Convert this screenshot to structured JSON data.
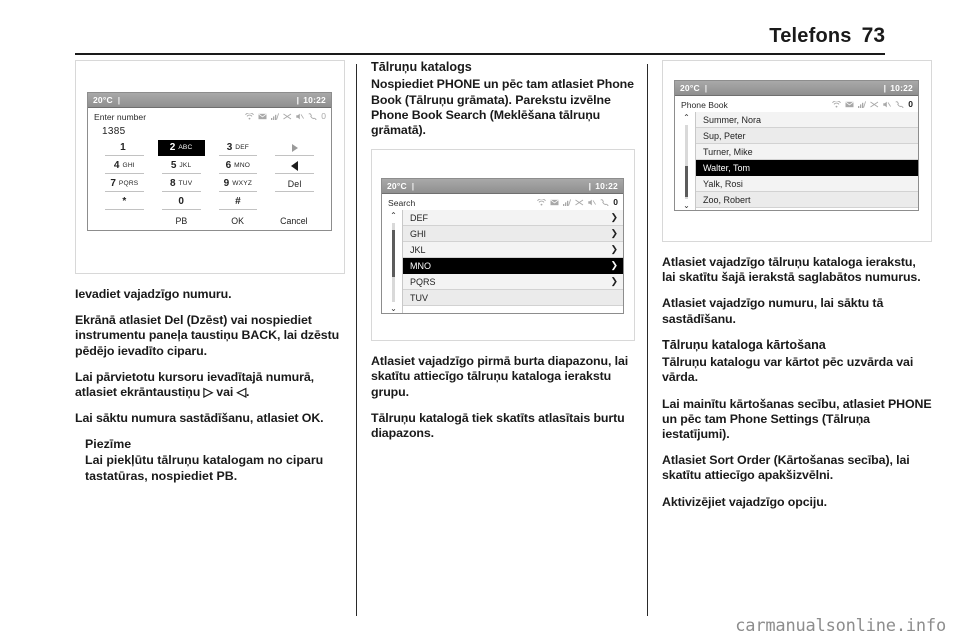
{
  "header": {
    "title": "Telefons",
    "page_number": "73"
  },
  "watermark": "carmanualsonline.info",
  "left_column": {
    "figure": {
      "status": {
        "temp": "20°C",
        "separator": "|",
        "clock": "10:22",
        "clock_sep": "|"
      },
      "screen_title": "Enter number",
      "icons": [
        "wifi-icon",
        "envelope-icon",
        "signal-icon",
        "shuffle-icon",
        "mute-icon",
        "handset-icon",
        "zero-indicator"
      ],
      "zero_indicator": "0",
      "entered_number": "1385",
      "keys": [
        {
          "num": "1",
          "letters": ""
        },
        {
          "num": "2",
          "letters": "ABC",
          "selected": true
        },
        {
          "num": "3",
          "letters": "DEF"
        },
        {
          "num": "",
          "letters": "",
          "glyph": "arrow-right"
        },
        {
          "num": "4",
          "letters": "GHI"
        },
        {
          "num": "5",
          "letters": "JKL"
        },
        {
          "num": "6",
          "letters": "MNO"
        },
        {
          "num": "",
          "letters": "",
          "glyph": "arrow-left"
        },
        {
          "num": "7",
          "letters": "PQRS"
        },
        {
          "num": "8",
          "letters": "TUV"
        },
        {
          "num": "9",
          "letters": "WXYZ"
        },
        {
          "num": "",
          "letters": "",
          "label": "Del"
        },
        {
          "num": "*",
          "letters": ""
        },
        {
          "num": "0",
          "letters": ""
        },
        {
          "num": "#",
          "letters": ""
        },
        {
          "num": "",
          "letters": "",
          "blank": true
        }
      ],
      "softkeys": [
        "",
        "PB",
        "OK",
        "Cancel"
      ]
    },
    "paragraphs": [
      "Ievadiet vajadzīgo numuru.",
      "Ekrānā atlasiet Del (Dzēst) vai nospiediet instrumentu paneļa taustiņu BACK, lai dzēstu pēdējo ievadīto ciparu.",
      "Lai pārvietotu kursoru ievadītajā numurā, atlasiet ekrāntaustiņu ▷ vai ◁.",
      "Lai sāktu numura sastādīšanu, atlasiet OK."
    ],
    "note": {
      "title": "Piezīme",
      "text": "Lai piekļūtu tālruņu katalogam no ciparu tastatūras, nospiediet PB."
    }
  },
  "middle_column": {
    "heading": "Tālruņu katalogs",
    "intro": "Nospiediet PHONE un pēc tam atlasiet Phone Book (Tālruņu grāmata). Parekstu izvēlne Phone Book Search (Meklēšana tālruņu grāmatā).",
    "figure": {
      "status": {
        "temp": "20°C",
        "separator": "|",
        "clock": "10:22",
        "clock_sep": "|"
      },
      "screen_title": "Search",
      "zero_indicator": "0",
      "items": [
        {
          "label": "DEF",
          "arrow": "❯"
        },
        {
          "label": "GHI",
          "arrow": "❯"
        },
        {
          "label": "JKL",
          "arrow": "❯"
        },
        {
          "label": "MNO",
          "arrow": "❯",
          "selected": true
        },
        {
          "label": "PQRS",
          "arrow": "❯"
        },
        {
          "label": "TUV",
          "arrow": ""
        }
      ],
      "scroll_up": "⌃",
      "scroll_down": "⌄"
    },
    "paragraphs": [
      "Atlasiet vajadzīgo pirmā burta diapazonu, lai skatītu attiecīgo tālruņu kataloga ierakstu grupu.",
      "Tālruņu katalogā tiek skatīts atlasītais burtu diapazons."
    ]
  },
  "right_column": {
    "figure": {
      "status": {
        "temp": "20°C",
        "separator": "|",
        "clock": "10:22",
        "clock_sep": "|"
      },
      "screen_title": "Phone Book",
      "zero_indicator": "0",
      "items": [
        {
          "label": "Summer, Nora"
        },
        {
          "label": "Sup, Peter"
        },
        {
          "label": "Turner, Mike"
        },
        {
          "label": "Walter, Tom",
          "selected": true
        },
        {
          "label": "Yalk, Rosi"
        },
        {
          "label": "Zoo, Robert"
        }
      ],
      "scroll_up": "⌃",
      "scroll_down": "⌄"
    },
    "paragraphs": [
      "Atlasiet vajadzīgo tālruņu kataloga ierakstu, lai skatītu šajā ierakstā saglabātos numurus.",
      "Atlasiet vajadzīgo numuru, lai sāktu tā sastādīšanu."
    ],
    "subheading": "Tālruņu kataloga kārtošana",
    "paragraphs2": [
      "Tālruņu katalogu var kārtot pēc uzvārda vai vārda.",
      "Lai mainītu kārtošanas secību, atlasiet PHONE un pēc tam Phone Settings (Tālruņa iestatījumi).",
      "Atlasiet Sort Order (Kārtošanas secība), lai skatītu attiecīgo apakšizvēlni.",
      "Aktivizējiet vajadzīgo opciju."
    ]
  }
}
